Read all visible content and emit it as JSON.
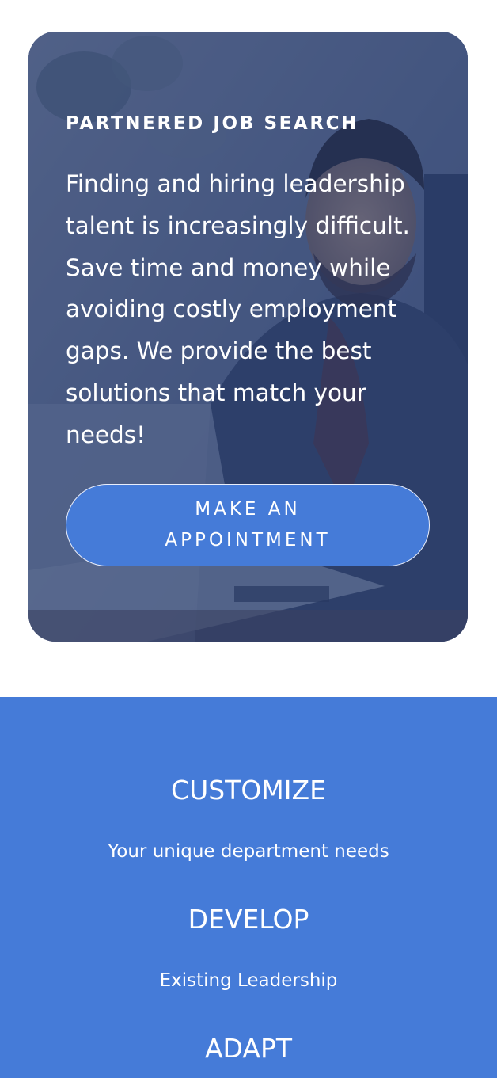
{
  "hero": {
    "eyebrow": "PARTNERED JOB SEARCH",
    "body": "Finding and hiring leadership talent is increasingly difficult. Save time and money while avoiding costly employment gaps. We provide the best solutions that match your needs!",
    "cta_label": "MAKE AN APPOINTMENT",
    "background_image": "man-at-laptop-photo"
  },
  "features": {
    "items": [
      {
        "heading": "CUSTOMIZE",
        "text": "Your unique department needs"
      },
      {
        "heading": "DEVELOP",
        "text": "Existing Leadership"
      },
      {
        "heading": "ADAPT"
      }
    ]
  },
  "colors": {
    "accent": "#457bd8",
    "overlay": "#203464",
    "text_on_dark": "#ffffff"
  }
}
